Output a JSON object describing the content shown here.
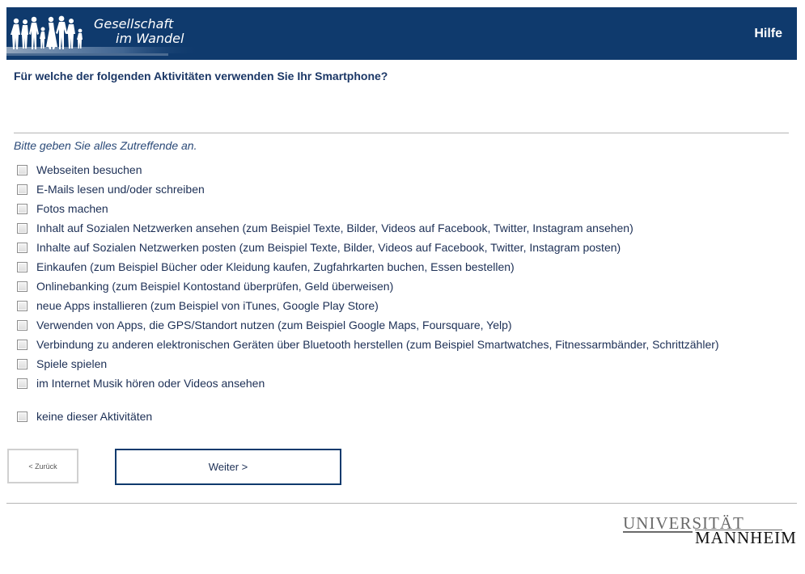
{
  "header": {
    "logo_line1": "Gesellschaft",
    "logo_line2": "im Wandel",
    "help_label": "Hilfe"
  },
  "question": "Für welche der folgenden Aktivitäten verwenden Sie Ihr Smartphone?",
  "instruction": "Bitte geben Sie alles Zutreffende an.",
  "options": [
    {
      "label": "Webseiten besuchen",
      "checked": false
    },
    {
      "label": "E-Mails lesen und/oder schreiben",
      "checked": false
    },
    {
      "label": "Fotos machen",
      "checked": false
    },
    {
      "label": "Inhalt auf Sozialen Netzwerken ansehen (zum Beispiel Texte, Bilder, Videos auf Facebook, Twitter, Instagram ansehen)",
      "checked": false
    },
    {
      "label": "Inhalte auf Sozialen Netzwerken posten (zum Beispiel Texte, Bilder, Videos auf Facebook, Twitter, Instagram posten)",
      "checked": false
    },
    {
      "label": "Einkaufen (zum Beispiel Bücher oder Kleidung kaufen, Zugfahrkarten buchen, Essen bestellen)",
      "checked": false
    },
    {
      "label": "Onlinebanking (zum Beispiel Kontostand überprüfen, Geld überweisen)",
      "checked": false
    },
    {
      "label": "neue Apps installieren (zum Beispiel von iTunes, Google Play Store)",
      "checked": false
    },
    {
      "label": "Verwenden von Apps, die GPS/Standort nutzen (zum Beispiel Google Maps, Foursquare, Yelp)",
      "checked": false
    },
    {
      "label": "Verbindung zu anderen elektronischen Geräten über Bluetooth herstellen (zum Beispiel Smartwatches, Fitnessarmbänder, Schrittzähler)",
      "checked": false
    },
    {
      "label": "Spiele spielen",
      "checked": false
    },
    {
      "label": "im Internet Musik hören oder Videos ansehen",
      "checked": false
    }
  ],
  "none_option": {
    "label": "keine dieser Aktivitäten",
    "checked": false
  },
  "nav": {
    "back_label": "< Zurück",
    "next_label": "Weiter >"
  },
  "footer": {
    "university_line1": "UNIVERSITÄT",
    "university_line2": "MANNHEIM"
  },
  "colors": {
    "header_bg": "#0f3a6d",
    "text_primary": "#1c2f55"
  }
}
